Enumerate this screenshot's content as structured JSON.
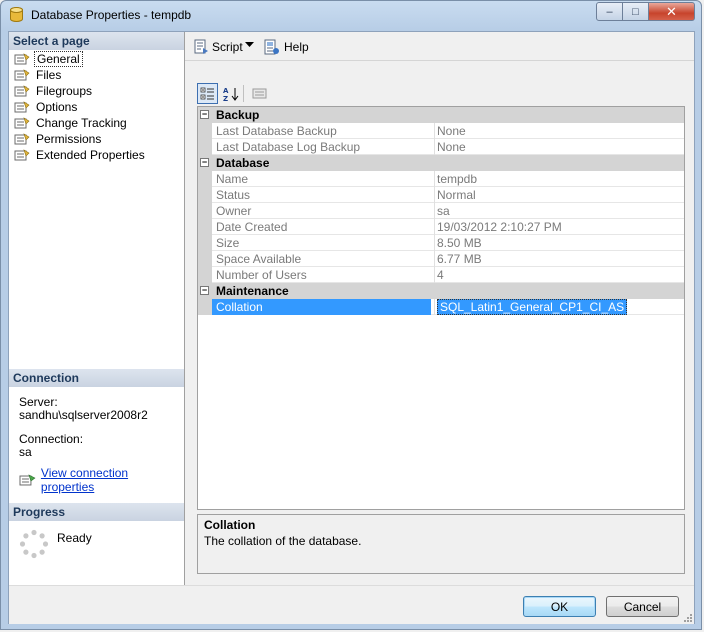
{
  "window": {
    "title": "Database Properties - tempdb",
    "controls": {
      "minimize": "–",
      "maximize": "□",
      "close": "✕"
    }
  },
  "left_pane": {
    "select_page_header": "Select a page",
    "pages": [
      {
        "label": "General",
        "icon": "properties-page-icon",
        "selected": true
      },
      {
        "label": "Files",
        "icon": "properties-page-icon"
      },
      {
        "label": "Filegroups",
        "icon": "properties-page-icon"
      },
      {
        "label": "Options",
        "icon": "properties-page-icon"
      },
      {
        "label": "Change Tracking",
        "icon": "properties-page-icon"
      },
      {
        "label": "Permissions",
        "icon": "properties-page-icon"
      },
      {
        "label": "Extended Properties",
        "icon": "properties-page-icon"
      }
    ],
    "connection": {
      "header": "Connection",
      "server_label": "Server:",
      "server_value": "sandhu\\sqlserver2008r2",
      "connection_label": "Connection:",
      "connection_value": "sa",
      "view_link": "View connection properties"
    },
    "progress": {
      "header": "Progress",
      "status": "Ready"
    }
  },
  "toolbar": {
    "script_label": "Script",
    "help_label": "Help"
  },
  "property_grid": {
    "categories": [
      {
        "label": "Backup",
        "rows": [
          {
            "name": "Last Database Backup",
            "value": "None"
          },
          {
            "name": "Last Database Log Backup",
            "value": "None"
          }
        ]
      },
      {
        "label": "Database",
        "rows": [
          {
            "name": "Name",
            "value": "tempdb"
          },
          {
            "name": "Status",
            "value": "Normal"
          },
          {
            "name": "Owner",
            "value": "sa"
          },
          {
            "name": "Date Created",
            "value": "19/03/2012 2:10:27 PM"
          },
          {
            "name": "Size",
            "value": "8.50 MB"
          },
          {
            "name": "Space Available",
            "value": "6.77 MB"
          },
          {
            "name": "Number of Users",
            "value": "4"
          }
        ]
      },
      {
        "label": "Maintenance",
        "rows": [
          {
            "name": "Collation",
            "value": "SQL_Latin1_General_CP1_CI_AS",
            "selected": true
          }
        ]
      }
    ],
    "toggle_glyph": "−"
  },
  "description": {
    "title": "Collation",
    "text": "The collation of the database."
  },
  "buttons": {
    "ok": "OK",
    "cancel": "Cancel"
  },
  "colors": {
    "selection": "#3399ff",
    "category_bg": "#d4d4d4",
    "link": "#0033cc"
  }
}
